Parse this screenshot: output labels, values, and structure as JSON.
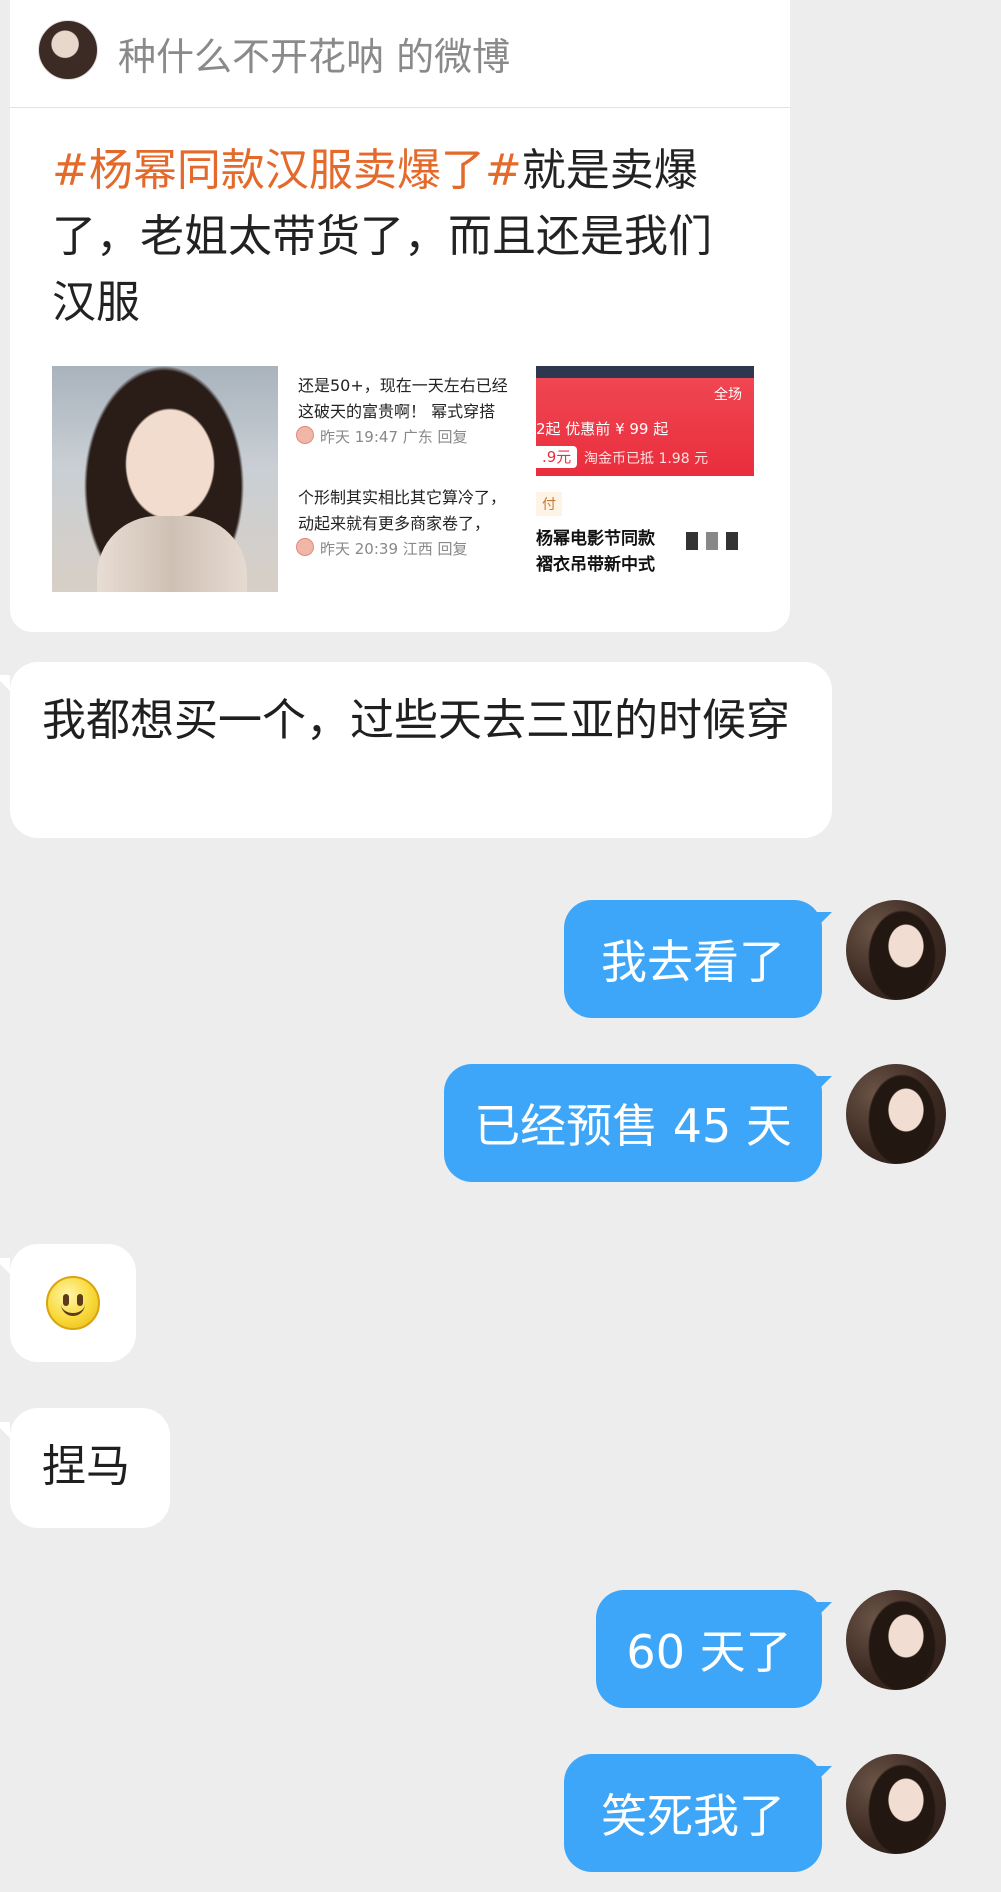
{
  "shared_post": {
    "source": "种什么不开花呐 的微博",
    "hashtag": "#杨幂同款汉服卖爆了#",
    "text": "就是卖爆了，老姐太带货了，而且还是我们汉服",
    "thumb2": {
      "comment1_line1": "还是50+，现在一天左右已经",
      "comment1_line2": "这破天的富贵啊！ 幂式穿搭",
      "meta1": "昨天 19:47 广东 回复",
      "comment2_line1": "个形制其实相比其它算冷了，",
      "comment2_line2": "动起来就有更多商家卷了，",
      "meta2": "昨天 20:39 江西 回复"
    },
    "thumb3": {
      "corner": "全场",
      "price_line": "2起  优惠前 ¥ 99 起",
      "price_tag": ".9元",
      "coin_line": "淘金币已抵 1.98 元",
      "pay_tag": "付",
      "title_line1": "杨幂电影节同款",
      "title_line2": "褶衣吊带新中式"
    }
  },
  "messages": [
    {
      "side": "left",
      "text": "我都想买一个，过些天去三亚的时候穿"
    },
    {
      "side": "right",
      "text": "我去看了"
    },
    {
      "side": "right",
      "text": "已经预售 45 天"
    },
    {
      "side": "left",
      "type": "emoji",
      "emoji": "smiley-icon"
    },
    {
      "side": "left",
      "text": "捏马"
    },
    {
      "side": "right",
      "text": "60 天了"
    },
    {
      "side": "right",
      "text": "笑死我了"
    }
  ],
  "colors": {
    "background": "#ededed",
    "bubble_right": "#3ea6f8",
    "bubble_left": "#ffffff",
    "hashtag": "#e46a2b"
  }
}
